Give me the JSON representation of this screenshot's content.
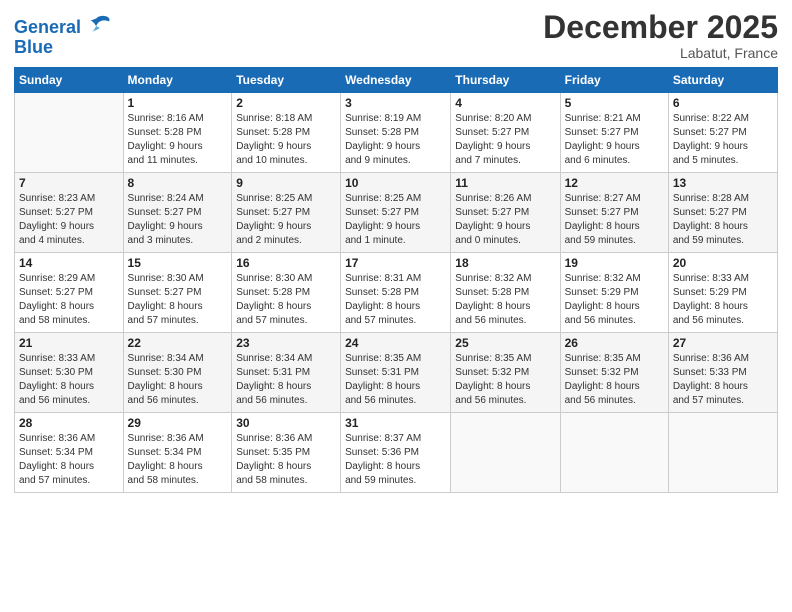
{
  "header": {
    "logo_line1": "General",
    "logo_line2": "Blue",
    "month": "December 2025",
    "location": "Labatut, France"
  },
  "days_of_week": [
    "Sunday",
    "Monday",
    "Tuesday",
    "Wednesday",
    "Thursday",
    "Friday",
    "Saturday"
  ],
  "weeks": [
    [
      {
        "day": "",
        "info": ""
      },
      {
        "day": "1",
        "info": "Sunrise: 8:16 AM\nSunset: 5:28 PM\nDaylight: 9 hours\nand 11 minutes."
      },
      {
        "day": "2",
        "info": "Sunrise: 8:18 AM\nSunset: 5:28 PM\nDaylight: 9 hours\nand 10 minutes."
      },
      {
        "day": "3",
        "info": "Sunrise: 8:19 AM\nSunset: 5:28 PM\nDaylight: 9 hours\nand 9 minutes."
      },
      {
        "day": "4",
        "info": "Sunrise: 8:20 AM\nSunset: 5:27 PM\nDaylight: 9 hours\nand 7 minutes."
      },
      {
        "day": "5",
        "info": "Sunrise: 8:21 AM\nSunset: 5:27 PM\nDaylight: 9 hours\nand 6 minutes."
      },
      {
        "day": "6",
        "info": "Sunrise: 8:22 AM\nSunset: 5:27 PM\nDaylight: 9 hours\nand 5 minutes."
      }
    ],
    [
      {
        "day": "7",
        "info": "Sunrise: 8:23 AM\nSunset: 5:27 PM\nDaylight: 9 hours\nand 4 minutes."
      },
      {
        "day": "8",
        "info": "Sunrise: 8:24 AM\nSunset: 5:27 PM\nDaylight: 9 hours\nand 3 minutes."
      },
      {
        "day": "9",
        "info": "Sunrise: 8:25 AM\nSunset: 5:27 PM\nDaylight: 9 hours\nand 2 minutes."
      },
      {
        "day": "10",
        "info": "Sunrise: 8:25 AM\nSunset: 5:27 PM\nDaylight: 9 hours\nand 1 minute."
      },
      {
        "day": "11",
        "info": "Sunrise: 8:26 AM\nSunset: 5:27 PM\nDaylight: 9 hours\nand 0 minutes."
      },
      {
        "day": "12",
        "info": "Sunrise: 8:27 AM\nSunset: 5:27 PM\nDaylight: 8 hours\nand 59 minutes."
      },
      {
        "day": "13",
        "info": "Sunrise: 8:28 AM\nSunset: 5:27 PM\nDaylight: 8 hours\nand 59 minutes."
      }
    ],
    [
      {
        "day": "14",
        "info": "Sunrise: 8:29 AM\nSunset: 5:27 PM\nDaylight: 8 hours\nand 58 minutes."
      },
      {
        "day": "15",
        "info": "Sunrise: 8:30 AM\nSunset: 5:27 PM\nDaylight: 8 hours\nand 57 minutes."
      },
      {
        "day": "16",
        "info": "Sunrise: 8:30 AM\nSunset: 5:28 PM\nDaylight: 8 hours\nand 57 minutes."
      },
      {
        "day": "17",
        "info": "Sunrise: 8:31 AM\nSunset: 5:28 PM\nDaylight: 8 hours\nand 57 minutes."
      },
      {
        "day": "18",
        "info": "Sunrise: 8:32 AM\nSunset: 5:28 PM\nDaylight: 8 hours\nand 56 minutes."
      },
      {
        "day": "19",
        "info": "Sunrise: 8:32 AM\nSunset: 5:29 PM\nDaylight: 8 hours\nand 56 minutes."
      },
      {
        "day": "20",
        "info": "Sunrise: 8:33 AM\nSunset: 5:29 PM\nDaylight: 8 hours\nand 56 minutes."
      }
    ],
    [
      {
        "day": "21",
        "info": "Sunrise: 8:33 AM\nSunset: 5:30 PM\nDaylight: 8 hours\nand 56 minutes."
      },
      {
        "day": "22",
        "info": "Sunrise: 8:34 AM\nSunset: 5:30 PM\nDaylight: 8 hours\nand 56 minutes."
      },
      {
        "day": "23",
        "info": "Sunrise: 8:34 AM\nSunset: 5:31 PM\nDaylight: 8 hours\nand 56 minutes."
      },
      {
        "day": "24",
        "info": "Sunrise: 8:35 AM\nSunset: 5:31 PM\nDaylight: 8 hours\nand 56 minutes."
      },
      {
        "day": "25",
        "info": "Sunrise: 8:35 AM\nSunset: 5:32 PM\nDaylight: 8 hours\nand 56 minutes."
      },
      {
        "day": "26",
        "info": "Sunrise: 8:35 AM\nSunset: 5:32 PM\nDaylight: 8 hours\nand 56 minutes."
      },
      {
        "day": "27",
        "info": "Sunrise: 8:36 AM\nSunset: 5:33 PM\nDaylight: 8 hours\nand 57 minutes."
      }
    ],
    [
      {
        "day": "28",
        "info": "Sunrise: 8:36 AM\nSunset: 5:34 PM\nDaylight: 8 hours\nand 57 minutes."
      },
      {
        "day": "29",
        "info": "Sunrise: 8:36 AM\nSunset: 5:34 PM\nDaylight: 8 hours\nand 58 minutes."
      },
      {
        "day": "30",
        "info": "Sunrise: 8:36 AM\nSunset: 5:35 PM\nDaylight: 8 hours\nand 58 minutes."
      },
      {
        "day": "31",
        "info": "Sunrise: 8:37 AM\nSunset: 5:36 PM\nDaylight: 8 hours\nand 59 minutes."
      },
      {
        "day": "",
        "info": ""
      },
      {
        "day": "",
        "info": ""
      },
      {
        "day": "",
        "info": ""
      }
    ]
  ]
}
